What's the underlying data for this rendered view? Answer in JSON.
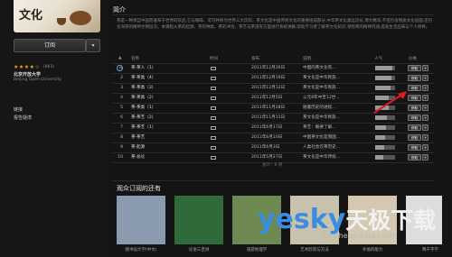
{
  "sidebar": {
    "cover_text": "文化",
    "subscribe_label": "订阅",
    "subscribe_arrow": "▾",
    "stars": "★★★★☆",
    "rating_count": "(863)",
    "publisher": "北京开放大学",
    "publisher_en": "Beijing Open University",
    "links": [
      "链接",
      "报告疑虑"
    ]
  },
  "intro": {
    "title": "简介",
    "description": "茶是一种源自中国而遍布于世界的饮品,它与咖啡、可可并称为世界三大饮料。茶文化是中国传统文化的重要组成部分,中华茶文化源远流长,博大精深,不但包含物质文化层面,还包含深厚的精神文明层次。本课程从茶的起源、茶的种类、茶的冲泡、茶艺与茶道等方面进行系统讲解,帮助学习者了解茶文化知识,领悟茶的精神内涵,提高生活品味与个人修养。"
  },
  "table": {
    "headers": [
      "名称",
      "时间",
      "发布",
      "说明",
      "人气",
      "价格"
    ],
    "rows": [
      {
        "num": "1",
        "name": "茶·茶人（1）",
        "date": "2011年12月26日",
        "desc": "中国的茶文化有...",
        "pop": 0.85,
        "btn": "获取"
      },
      {
        "num": "2",
        "name": "茶·茶类（4）",
        "date": "2011年12月19日",
        "desc": "茶文化是中华民族...",
        "pop": 0.8,
        "btn": "获取"
      },
      {
        "num": "3",
        "name": "茶·茶类（3）",
        "date": "2011年12月12日",
        "desc": "茶文化是中华民族...",
        "pop": 0.75,
        "btn": "获取"
      },
      {
        "num": "4",
        "name": "茶·茶类（2）",
        "date": "2011年12月5日",
        "desc": "公元8年中至12世...",
        "pop": 0.7,
        "btn": "获取"
      },
      {
        "num": "5",
        "name": "茶·茶类（1）",
        "date": "2011年11月28日",
        "desc": "随着历史的进程...",
        "pop": 0.68,
        "btn": "获取"
      },
      {
        "num": "6",
        "name": "茶·茶艺（2）",
        "date": "2011年11月11日",
        "desc": "茶文化是中华民族...",
        "pop": 0.6,
        "btn": "获取"
      },
      {
        "num": "7",
        "name": "茶·茶艺（1）",
        "date": "2011年6月17日",
        "desc": "茶艺：概要了解...",
        "pop": 0.55,
        "btn": "获取"
      },
      {
        "num": "8",
        "name": "茶·茶艺",
        "date": "2011年6月10日",
        "desc": "中国茶文化是我国...",
        "pop": 0.5,
        "btn": "获取"
      },
      {
        "num": "9",
        "name": "茶·起源",
        "date": "2011年6月3日",
        "desc": "人类社会饮茶历史...",
        "pop": 0.45,
        "btn": "获取"
      },
      {
        "num": "10",
        "name": "茶·总论",
        "date": "2011年5月27日",
        "desc": "茶文化是中华传统...",
        "pop": 0.42,
        "btn": "获取"
      }
    ],
    "footer": "总计：9 项"
  },
  "also": {
    "title": "观众订阅的还有",
    "items": [
      {
        "label": "图书设计学(中文)",
        "color": "#8a9bb0"
      },
      {
        "label": "论语三百讲",
        "color": "#2f6b3a"
      },
      {
        "label": "旅游地理学",
        "color": "#6e8a52"
      },
      {
        "label": "艺术欣赏与方法",
        "color": "#c8c2ad"
      },
      {
        "label": "幸福的能力",
        "color": "#d4c9b0"
      },
      {
        "label": "两千字学",
        "color": "#ddd"
      }
    ]
  },
  "watermark": {
    "brand": "yesky",
    "cn": "天极下载",
    "sub": "jiaocheng.baidu.com"
  },
  "colors": {
    "accent": "#6aa6d8",
    "arrow": "#e01b1b",
    "star": "#e7a42b"
  }
}
